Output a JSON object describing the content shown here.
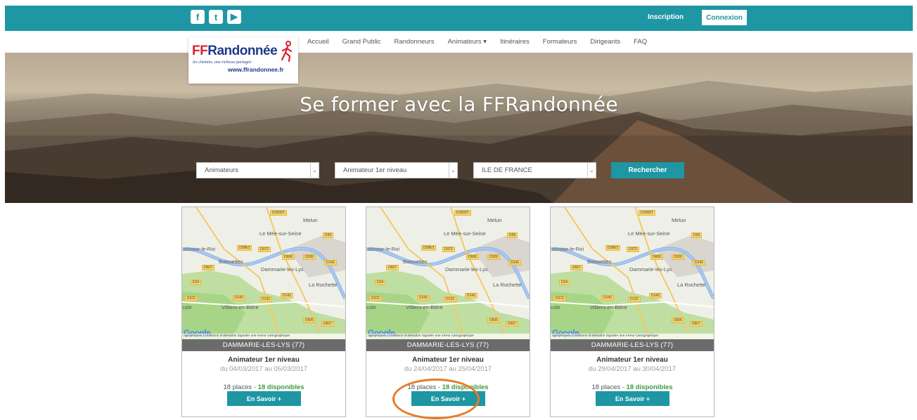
{
  "topbar": {
    "social": [
      {
        "icon": "facebook-icon",
        "glyph": "f"
      },
      {
        "icon": "twitter-icon",
        "glyph": "t"
      },
      {
        "icon": "youtube-icon",
        "glyph": "▶"
      }
    ],
    "inscription": "Inscription",
    "connexion": "Connexion"
  },
  "logo": {
    "brand_ff": "FF",
    "brand_rest": "Randonnée",
    "tagline": "les chemins, une richesse partagée",
    "url": "www.ffrandonnee.fr"
  },
  "nav": {
    "items": [
      "Accueil",
      "Grand Public",
      "Randonneurs",
      "Animateurs ▾",
      "Itinéraires",
      "Formateurs",
      "Dirigeants",
      "FAQ"
    ]
  },
  "hero": {
    "title": "Se former avec la FFRandonnée",
    "select1": "Animateurs",
    "select2": "Animateur 1er niveau",
    "select3": "ILE DE FRANCE",
    "search": "Rechercher"
  },
  "map": {
    "labels": [
      "Melun",
      "Le Mée-sur-Seine",
      "oissise-le-Roi",
      "Boissettes",
      "Dammarie-les-Lys",
      "La Rochette",
      "Villiers-en-Bière",
      "cole"
    ],
    "roads": [
      "D1009T",
      "D39",
      "D39E3",
      "D372",
      "D606",
      "D326",
      "D142",
      "D607",
      "D24",
      "D372",
      "D142",
      "D132",
      "D142",
      "D606",
      "D607"
    ],
    "google": "Google",
    "footer": "ographiques   Conditions d'utilisation   Signaler une erreur cartographique"
  },
  "cards": [
    {
      "place": "DAMMARIE-LES-LYS  (77)",
      "title": "Animateur 1er niveau",
      "dates": "du 04/03/2017 au 05/03/2017",
      "places": "18 places - ",
      "available": "18 disponibles",
      "button": "En Savoir +"
    },
    {
      "place": "DAMMARIE-LES-LYS  (77)",
      "title": "Animateur 1er niveau",
      "dates": "du 24/04/2017 au 25/04/2017",
      "places": "18 places - ",
      "available": "18 disponibles",
      "button": "En Savoir +"
    },
    {
      "place": "DAMMARIE-LES-LYS  (77)",
      "title": "Animateur 1er niveau",
      "dates": "du 29/04/2017 au 30/04/2017",
      "places": "18 places - ",
      "available": "18 disponibles",
      "button": "En Savoir +"
    }
  ],
  "colors": {
    "accent": "#1e96a3",
    "available": "#3c9b39",
    "highlight": "#e67a28",
    "brand_red": "#d9232e",
    "brand_blue": "#1e3a8a"
  }
}
